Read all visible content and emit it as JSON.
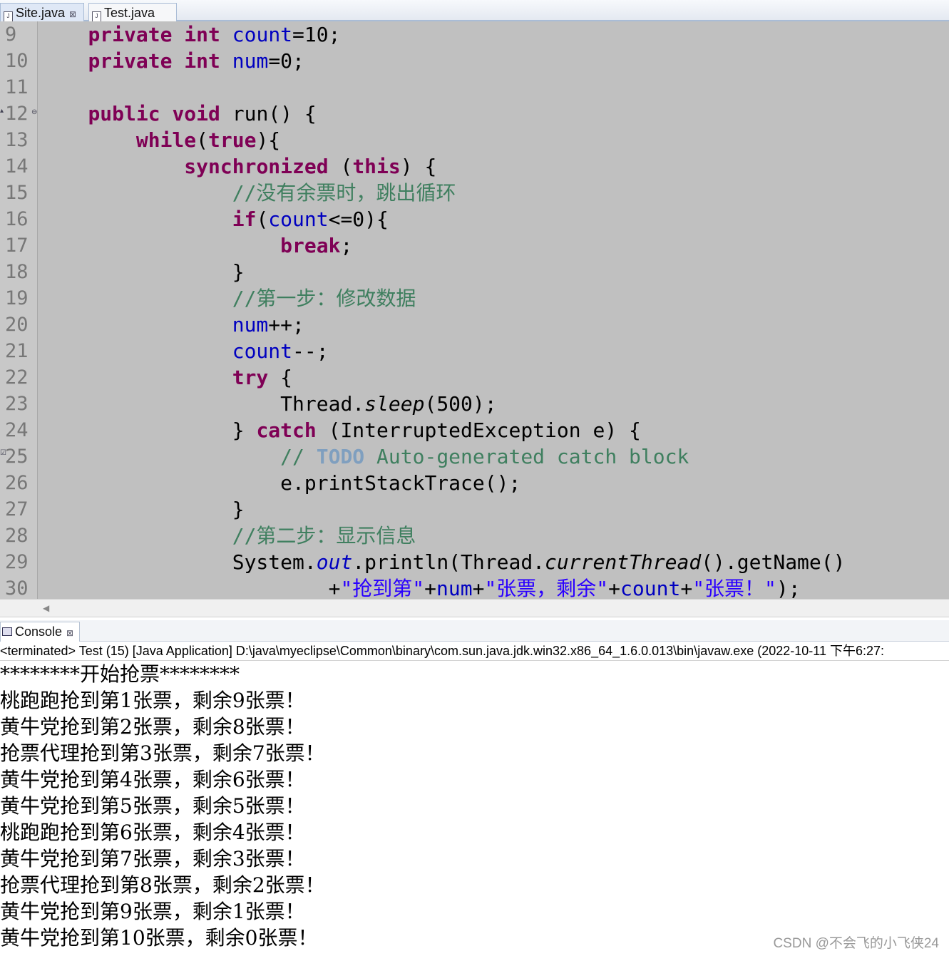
{
  "editor_tabs": [
    {
      "label": "Site.java",
      "active": true
    },
    {
      "label": "Test.java",
      "active": false
    }
  ],
  "tab_close_glyph": "⊠",
  "file_icon_glyph": "J",
  "line_numbers": [
    "9",
    "10",
    "11",
    "12",
    "13",
    "14",
    "15",
    "16",
    "17",
    "18",
    "19",
    "20",
    "21",
    "22",
    "23",
    "24",
    "25",
    "26",
    "27",
    "28",
    "29",
    "30"
  ],
  "code": {
    "kw_private": "private",
    "kw_int": "int",
    "field_count": "count",
    "field_num": "num",
    "l9_rest": "=10;",
    "l10_rest": "=0;",
    "kw_public": "public",
    "kw_void": "void",
    "l12_rest": "run() {",
    "kw_while": "while",
    "kw_true": "true",
    "kw_synchronized": "synchronized",
    "kw_this": "this",
    "l15_comment": "//没有余票时，跳出循环",
    "kw_if": "if",
    "l16_rest": "<=0){",
    "kw_break": "break",
    "l19_comment": "//第一步：修改数据",
    "l20_rest": "++;",
    "l21_rest": "--;",
    "kw_try": "try",
    "l23_class": "Thread.",
    "l23_method": "sleep",
    "l23_rest": "(500);",
    "kw_catch": "catch",
    "l24_rest": "(InterruptedException e) {",
    "l25_comment_start": "// ",
    "l25_todo": "TODO",
    "l25_comment_rest": " Auto-generated catch block",
    "l26_text": "e.printStackTrace();",
    "brace_close": "}",
    "l28_comment": "//第二步：显示信息",
    "l29_a": "System.",
    "l29_out": "out",
    "l29_b": ".println(Thread.",
    "l29_method": "currentThread",
    "l29_c": "().getName()",
    "l30_plus": "+",
    "l30_str1": "\"抢到第\"",
    "l30_str2": "\"张票，剩余\"",
    "l30_str3": "\"张票！\"",
    "l30_end": ");"
  },
  "console": {
    "tab_label": "Console",
    "status": "<terminated> Test (15) [Java Application] D:\\java\\myeclipse\\Common\\binary\\com.sun.java.jdk.win32.x86_64_1.6.0.013\\bin\\javaw.exe (2022-10-11 下午6:27:",
    "output": [
      "********开始抢票********",
      "桃跑跑抢到第1张票，剩余9张票！",
      "黄牛党抢到第2张票，剩余8张票！",
      "抢票代理抢到第3张票，剩余7张票！",
      "黄牛党抢到第4张票，剩余6张票！",
      "黄牛党抢到第5张票，剩余5张票！",
      "桃跑跑抢到第6张票，剩余4张票！",
      "黄牛党抢到第7张票，剩余3张票！",
      "抢票代理抢到第8张票，剩余2张票！",
      "黄牛党抢到第9张票，剩余1张票！",
      "黄牛党抢到第10张票，剩余0张票！"
    ]
  },
  "watermark": "CSDN @不会飞的小飞侠24",
  "colors": {
    "keyword": "#7f0055",
    "field": "#0000c0",
    "comment": "#3f7f5f",
    "todo": "#7f9fbf",
    "string": "#2a00ff",
    "editor_bg": "#c0c0c0"
  }
}
